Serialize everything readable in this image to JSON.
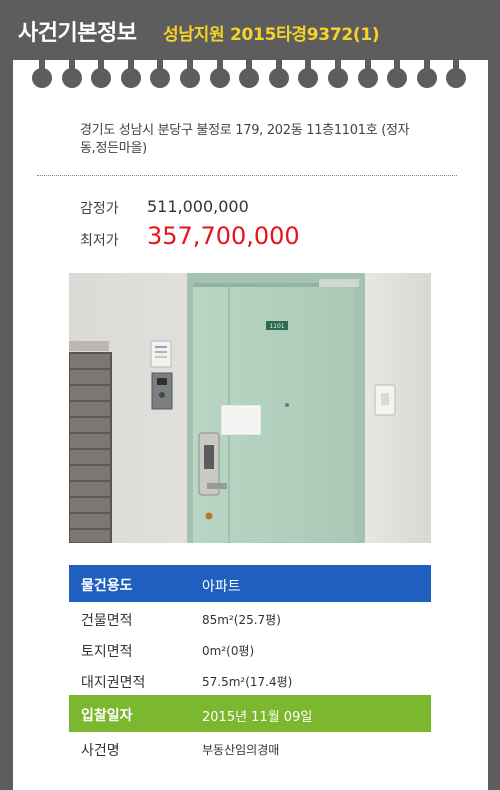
{
  "header": {
    "title": "사건기본정보",
    "subtitle": "성남지원 2015타경9372(1)"
  },
  "address": "경기도 성남시 분당구 불정로 179, 202동 11층1101호 (정자동,정든마을)",
  "price": {
    "appraisal_label": "감정가",
    "appraisal_value": "511,000,000",
    "minimum_label": "최저가",
    "minimum_value": "357,700,000"
  },
  "photo": {
    "door_number": "1101"
  },
  "details": [
    {
      "label": "물건용도",
      "value": "아파트"
    },
    {
      "label": "건물면적",
      "value": "85m²(25.7평)"
    },
    {
      "label": "토지면적",
      "value": "0m²(0평)"
    },
    {
      "label": "대지권면적",
      "value": "57.5m²(17.4평)"
    },
    {
      "label": "입찰일자",
      "value": "2015년 11월 09일"
    },
    {
      "label": "사건명",
      "value": "부동산임의경매"
    }
  ],
  "colors": {
    "background": "#5d5d5d",
    "subtitle": "#f5d327",
    "minimum_price": "#e8141b",
    "usage_row": "#1f5fbf",
    "bid_date_row": "#7cb82f"
  }
}
